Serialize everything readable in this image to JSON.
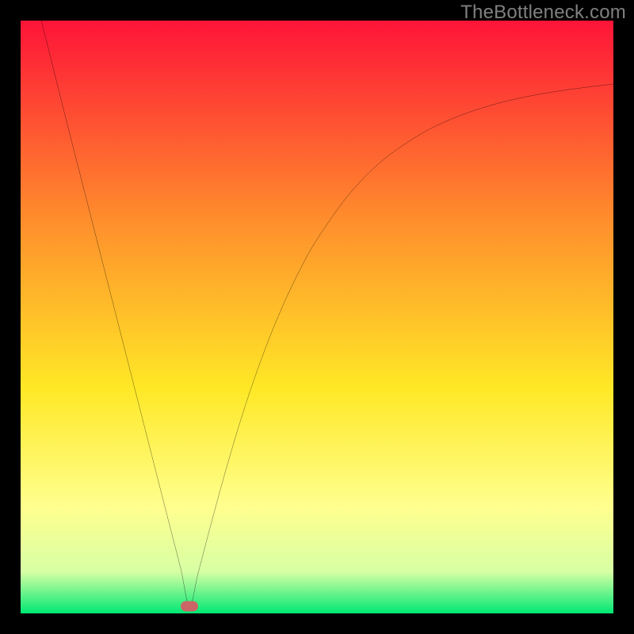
{
  "watermark": "TheBottleneck.com",
  "chart_data": {
    "type": "line",
    "title": "",
    "xlabel": "",
    "ylabel": "",
    "xlim": [
      0,
      100
    ],
    "ylim": [
      0,
      100
    ],
    "background_gradient": {
      "top": "#fe1438",
      "mid_upper": "#ff8f2c",
      "mid": "#ffe826",
      "mid_lower": "#ffff8e",
      "near_bottom": "#d7ffa4",
      "bottom": "#00e874"
    },
    "marker": {
      "x": 28.5,
      "y": 1.2,
      "color": "#cc6666"
    },
    "series": [
      {
        "name": "curve",
        "color": "#000000",
        "x": [
          3.5,
          5,
          7.5,
          10,
          12.5,
          15,
          17.5,
          20,
          22.5,
          25,
          27,
          28.5,
          30,
          32.5,
          35,
          37.5,
          40,
          42.5,
          45,
          47.5,
          50,
          55,
          60,
          65,
          70,
          75,
          80,
          85,
          90,
          95,
          100
        ],
        "y": [
          100,
          94,
          84,
          74.2,
          64.4,
          54.6,
          44.8,
          35,
          25.2,
          15.4,
          7.6,
          1.2,
          7,
          16.5,
          25.5,
          33.8,
          41.2,
          47.8,
          53.6,
          58.7,
          63.1,
          70.2,
          75.5,
          79.3,
          82.2,
          84.3,
          85.9,
          87.1,
          88.0,
          88.7,
          89.3
        ]
      }
    ]
  }
}
